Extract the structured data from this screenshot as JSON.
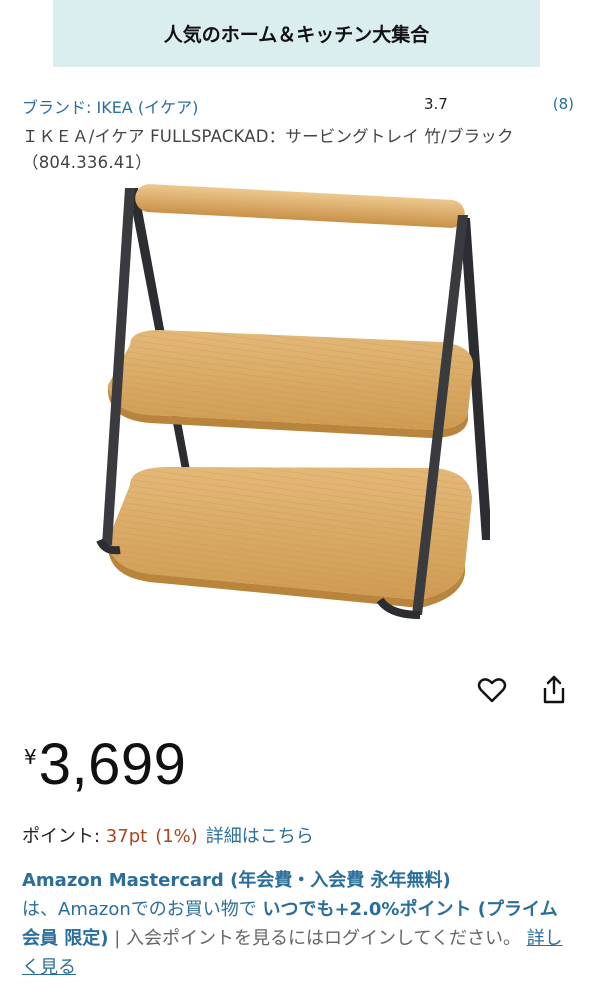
{
  "banner": {
    "text": "人気のホーム＆キッチン大集合"
  },
  "product": {
    "brand_label": "ブランド: IKEA (イケア)",
    "rating": "3.7",
    "rating_count": "(8)",
    "title": "ＩＫＥＡ/イケア FULLSPACKAD：サービングトレイ 竹/ブラック（804.336.41）",
    "image_alt": "IKEA FULLSPACKAD bamboo two-tier serving tray with black metal frame"
  },
  "actions": {
    "wishlist_icon": "heart-icon",
    "share_icon": "share-icon"
  },
  "price": {
    "symbol": "¥",
    "value": "3,699"
  },
  "points": {
    "label": "ポイント: ",
    "value": "37pt",
    "percent": "(1%)",
    "details_link": "詳細はこちら"
  },
  "mastercard": {
    "title": "Amazon Mastercard (年会費・入会費 永年無料)",
    "text1": "は、Amazonでのお買い物で ",
    "bold": "いつでも+2.0%ポイント (プライム会員 限定)",
    "separator": "|",
    "text2": " 入会ポイントを見るにはログインしてください。",
    "link": "詳しく見る"
  },
  "colors": {
    "link": "#2a6f9b",
    "points": "#a8461f",
    "banner_bg": "#daeef0",
    "bamboo": "#d9ab66",
    "frame": "#2c2d30"
  }
}
